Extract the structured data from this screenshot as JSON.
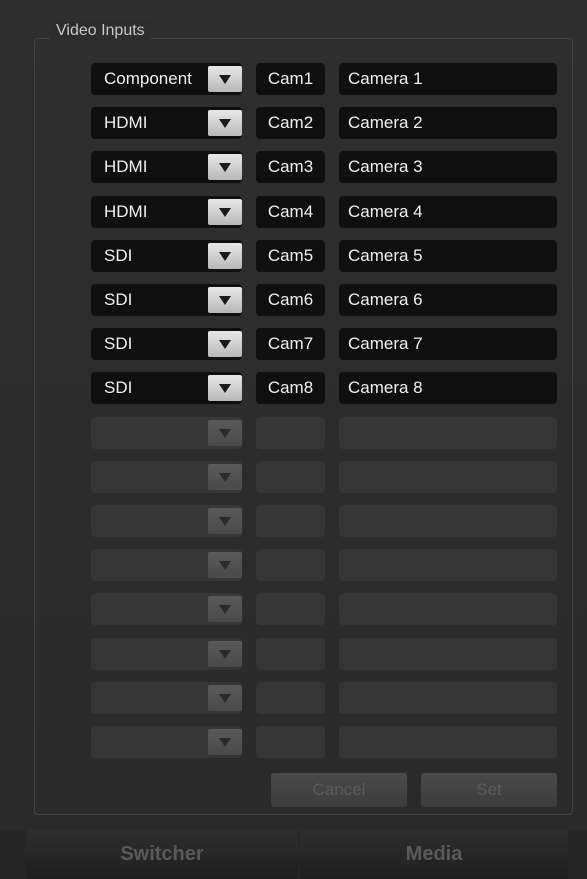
{
  "group_title": "Video Inputs",
  "inputs": [
    {
      "type": "Component",
      "short": "Cam1",
      "long": "Camera 1"
    },
    {
      "type": "HDMI",
      "short": "Cam2",
      "long": "Camera 2"
    },
    {
      "type": "HDMI",
      "short": "Cam3",
      "long": "Camera 3"
    },
    {
      "type": "HDMI",
      "short": "Cam4",
      "long": "Camera 4"
    },
    {
      "type": "SDI",
      "short": "Cam5",
      "long": "Camera 5"
    },
    {
      "type": "SDI",
      "short": "Cam6",
      "long": "Camera 6"
    },
    {
      "type": "SDI",
      "short": "Cam7",
      "long": "Camera 7"
    },
    {
      "type": "SDI",
      "short": "Cam8",
      "long": "Camera 8"
    },
    {
      "type": "",
      "short": "",
      "long": ""
    },
    {
      "type": "",
      "short": "",
      "long": ""
    },
    {
      "type": "",
      "short": "",
      "long": ""
    },
    {
      "type": "",
      "short": "",
      "long": ""
    },
    {
      "type": "",
      "short": "",
      "long": ""
    },
    {
      "type": "",
      "short": "",
      "long": ""
    },
    {
      "type": "",
      "short": "",
      "long": ""
    },
    {
      "type": "",
      "short": "",
      "long": ""
    }
  ],
  "buttons": {
    "cancel": "Cancel",
    "set": "Set"
  },
  "tabs": [
    {
      "label": "Switcher"
    },
    {
      "label": "Media"
    }
  ],
  "icons": {
    "dropdown": "triangle-down-icon"
  }
}
